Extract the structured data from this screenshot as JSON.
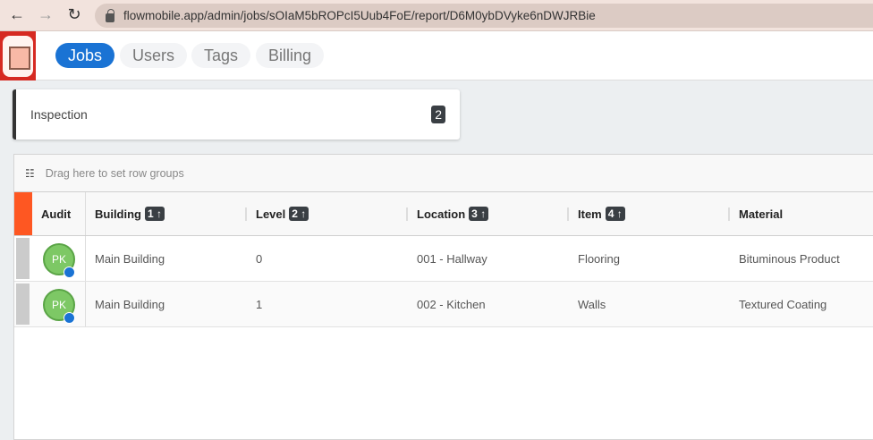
{
  "browser": {
    "url": "flowmobile.app/admin/jobs/sOIaM5bROPcI5Uub4FoE/report/D6M0ybDVyke6nDWJRBie"
  },
  "tabs": [
    {
      "label": "Jobs",
      "active": true
    },
    {
      "label": "Users"
    },
    {
      "label": "Tags"
    },
    {
      "label": "Billing"
    }
  ],
  "summary": {
    "label": "Inspection",
    "count": "2"
  },
  "grid": {
    "drop_hint": "Drag here to set row groups",
    "columns": [
      {
        "label": "Audit"
      },
      {
        "label": "Building",
        "sort": "1"
      },
      {
        "label": "Level",
        "sort": "2"
      },
      {
        "label": "Location",
        "sort": "3"
      },
      {
        "label": "Item",
        "sort": "4"
      },
      {
        "label": "Material"
      }
    ],
    "rows": [
      {
        "avatar": "PK",
        "building": "Main Building",
        "level": "0",
        "location": "001 - Hallway",
        "item": "Flooring",
        "material": "Bituminous Product"
      },
      {
        "avatar": "PK",
        "building": "Main Building",
        "level": "1",
        "location": "002 - Kitchen",
        "item": "Walls",
        "material": "Textured Coating"
      }
    ]
  },
  "colors": {
    "accent": "#1a73d4",
    "orange": "#fe5722",
    "avatar": "#7dc865"
  }
}
